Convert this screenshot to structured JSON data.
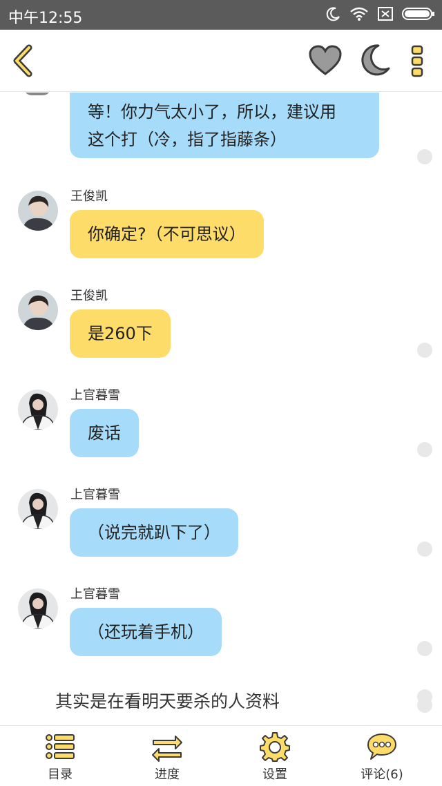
{
  "status_bar": {
    "time": "中午12:55"
  },
  "nav": {
    "back_icon": "back-chevron-icon",
    "heart_icon": "heart-icon",
    "moon_icon": "night-mode-moon-icon",
    "more_icon": "more-dots-icon"
  },
  "colors": {
    "accent_yellow": "#fedc6a",
    "bubble_blue": "#a6dcfa",
    "icon_gray": "#9a9a9a"
  },
  "messages": [
    {
      "text": "等！你力气太小了，所以，建议用这个打（冷，指了指藤条）",
      "line1": "等！你力气太小了，所以，建议用",
      "line2": "这个打（冷，指了指藤条）",
      "color": "blue"
    },
    {
      "sender": "王俊凯",
      "text": "你确定?（不可思议）",
      "color": "yellow"
    },
    {
      "sender": "王俊凯",
      "text": "是260下",
      "color": "yellow"
    },
    {
      "sender": "上官暮雪",
      "text": "废话",
      "color": "blue"
    },
    {
      "sender": "上官暮雪",
      "text": "（说完就趴下了）",
      "color": "blue"
    },
    {
      "sender": "上官暮雪",
      "text": "（还玩着手机）",
      "color": "blue"
    }
  ],
  "narration": "其实是在看明天要杀的人资料",
  "bottom_tabs": [
    {
      "label": "目录",
      "icon": "list-icon"
    },
    {
      "label": "进度",
      "icon": "swap-arrows-icon"
    },
    {
      "label": "设置",
      "icon": "gear-icon"
    },
    {
      "label": "评论(6)",
      "icon": "comment-bubble-icon"
    }
  ]
}
